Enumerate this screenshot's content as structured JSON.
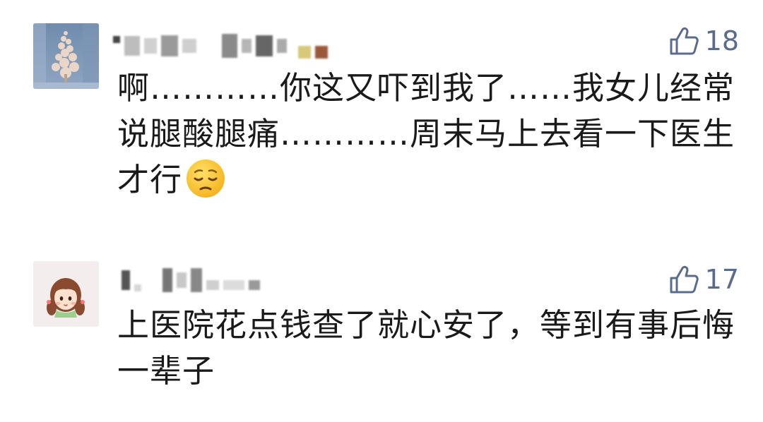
{
  "comments": [
    {
      "avatar_icon": "winter-tree-avatar",
      "username": "",
      "likes": "18",
      "like_icon": "thumbs-up-outline-icon",
      "text": "啊…………你这又吓到我了……我女儿经常说腿酸腿痛…………周末马上去看一下医生才行",
      "emoji": "pensive-face-emoji"
    },
    {
      "avatar_icon": "cartoon-girl-avatar",
      "username": "",
      "likes": "17",
      "like_icon": "thumbs-up-outline-icon",
      "text": "上医院花点钱查了就心安了，等到有事后悔一辈子"
    }
  ],
  "colors": {
    "like": "#5b6b8c",
    "text": "#1a1a1a",
    "background": "#ffffff"
  }
}
